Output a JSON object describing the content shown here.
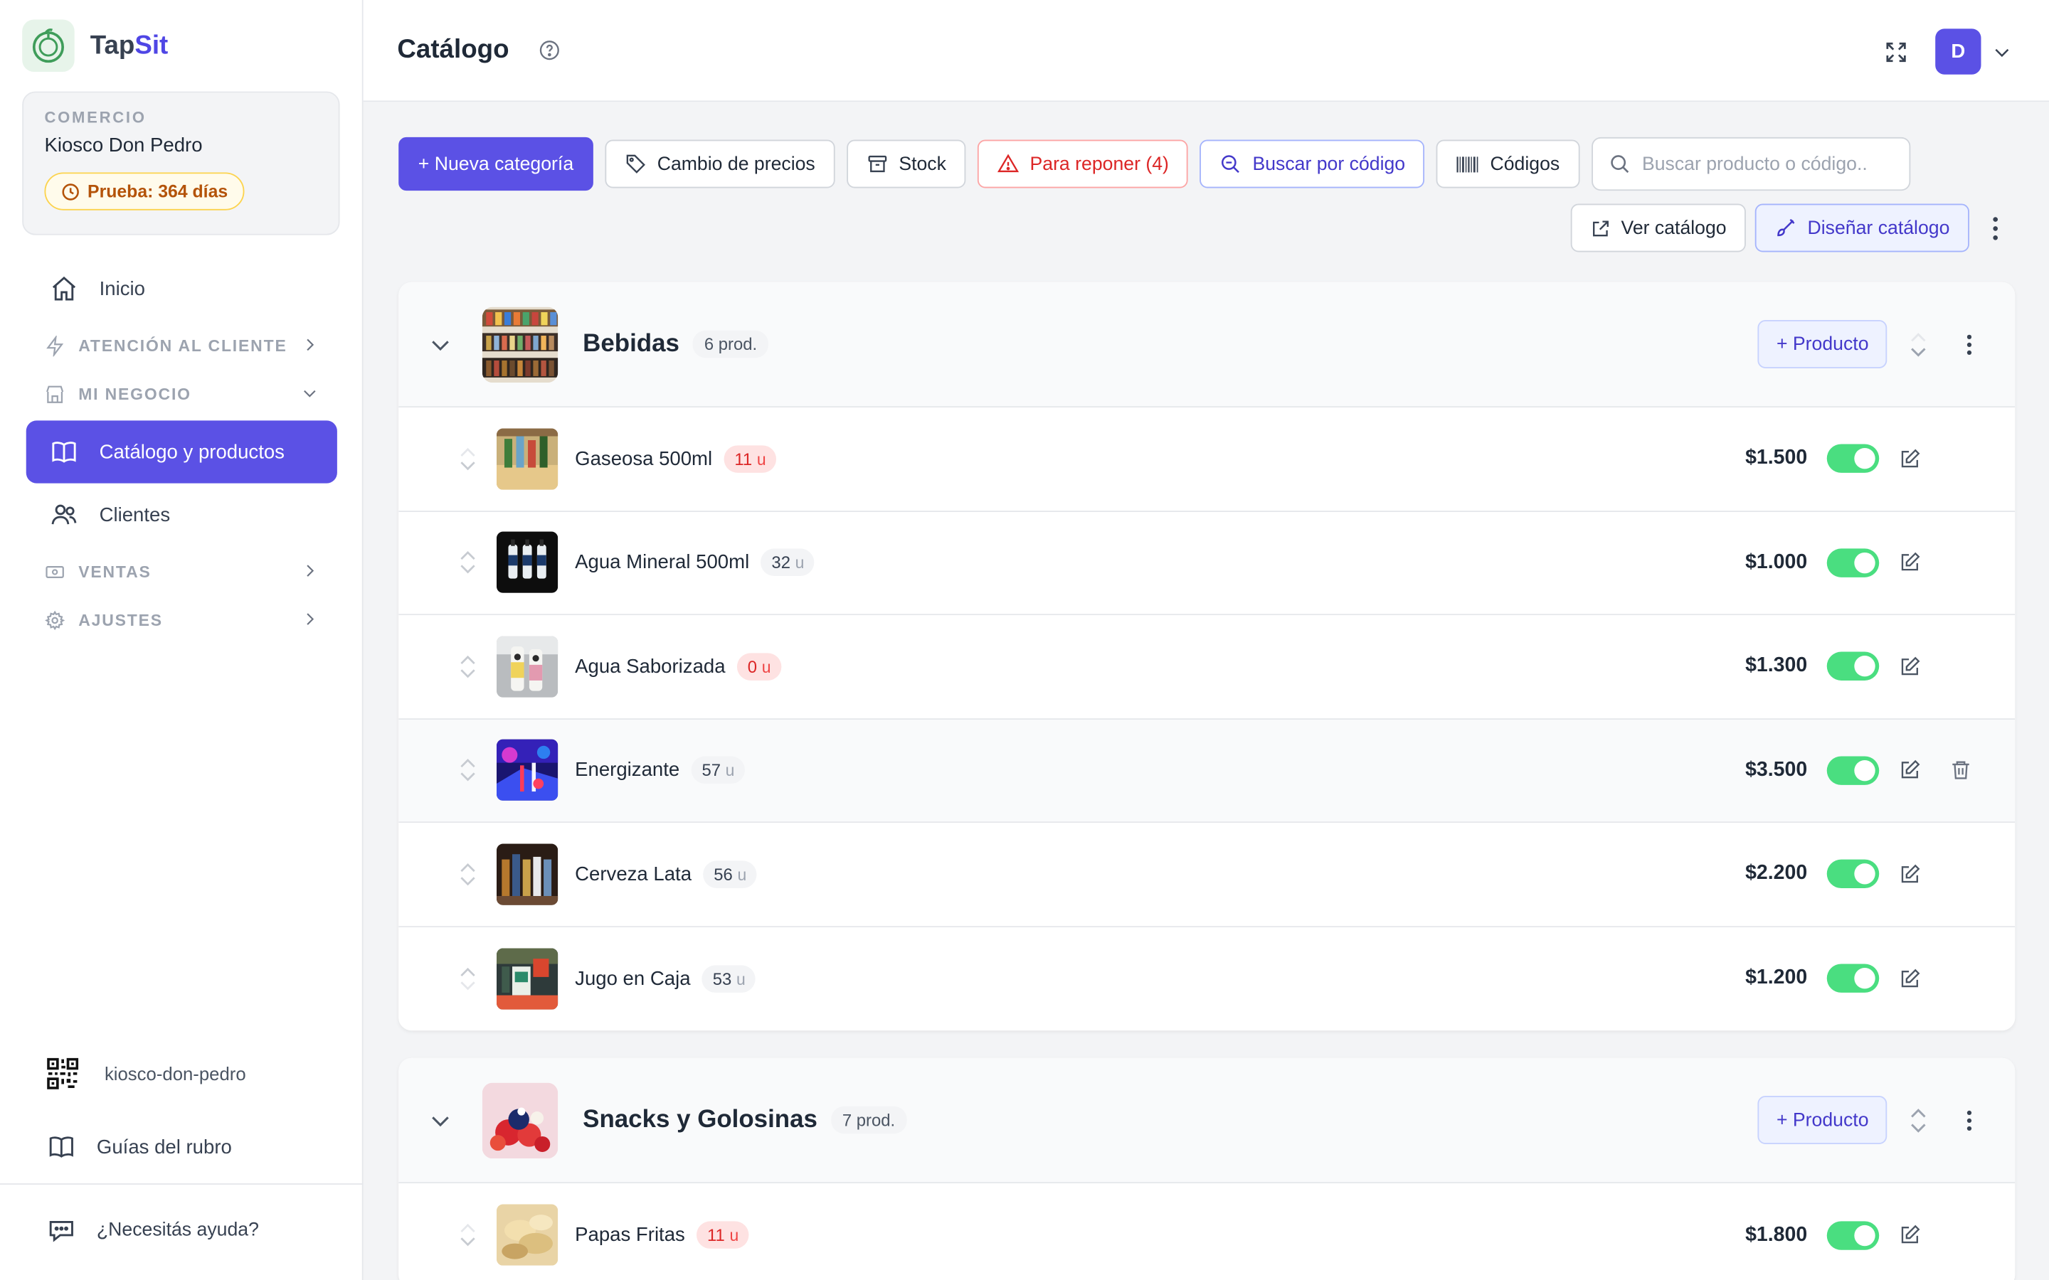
{
  "brand": {
    "prefix": "Tap",
    "accent": "Sit"
  },
  "shop": {
    "kicker": "COMERCIO",
    "name": "Kiosco Don Pedro",
    "trial": "Prueba: 364 días"
  },
  "nav": {
    "inicio": "Inicio",
    "atencion": "ATENCIÓN AL CLIENTE",
    "negocio": "MI NEGOCIO",
    "catalogo": "Catálogo y productos",
    "clientes": "Clientes",
    "ventas": "VENTAS",
    "ajustes": "AJUSTES"
  },
  "footer": {
    "slug": "kiosco-don-pedro",
    "guides": "Guías del rubro",
    "help": "¿Necesitás ayuda?"
  },
  "header": {
    "title": "Catálogo",
    "avatar": "D"
  },
  "toolbar": {
    "new_category": "+ Nueva categoría",
    "price_change": "Cambio de precios",
    "stock": "Stock",
    "restock": "Para reponer (4)",
    "search_code": "Buscar por código",
    "codes": "Códigos",
    "search_placeholder": "Buscar producto o código..",
    "view_catalog": "Ver catálogo",
    "design_catalog": "Diseñar catálogo"
  },
  "categories": [
    {
      "name": "Bebidas",
      "count": "6 prod.",
      "add_label": "+ Producto",
      "products": [
        {
          "name": "Gaseosa 500ml",
          "stock": "11",
          "unit": "u",
          "price": "$1.500",
          "low": true
        },
        {
          "name": "Agua Mineral 500ml",
          "stock": "32",
          "unit": "u",
          "price": "$1.000",
          "low": false
        },
        {
          "name": "Agua Saborizada",
          "stock": "0",
          "unit": "u",
          "price": "$1.300",
          "low": true
        },
        {
          "name": "Energizante",
          "stock": "57",
          "unit": "u",
          "price": "$3.500",
          "low": false
        },
        {
          "name": "Cerveza Lata",
          "stock": "56",
          "unit": "u",
          "price": "$2.200",
          "low": false
        },
        {
          "name": "Jugo en Caja",
          "stock": "53",
          "unit": "u",
          "price": "$1.200",
          "low": false
        }
      ]
    },
    {
      "name": "Snacks y Golosinas",
      "count": "7 prod.",
      "add_label": "+ Producto",
      "products": [
        {
          "name": "Papas Fritas",
          "stock": "11",
          "unit": "u",
          "price": "$1.800",
          "low": true
        }
      ]
    }
  ],
  "colors": {
    "primary": "#5b51e5",
    "toggle_on": "#4ade80",
    "danger": "#dc2626"
  }
}
